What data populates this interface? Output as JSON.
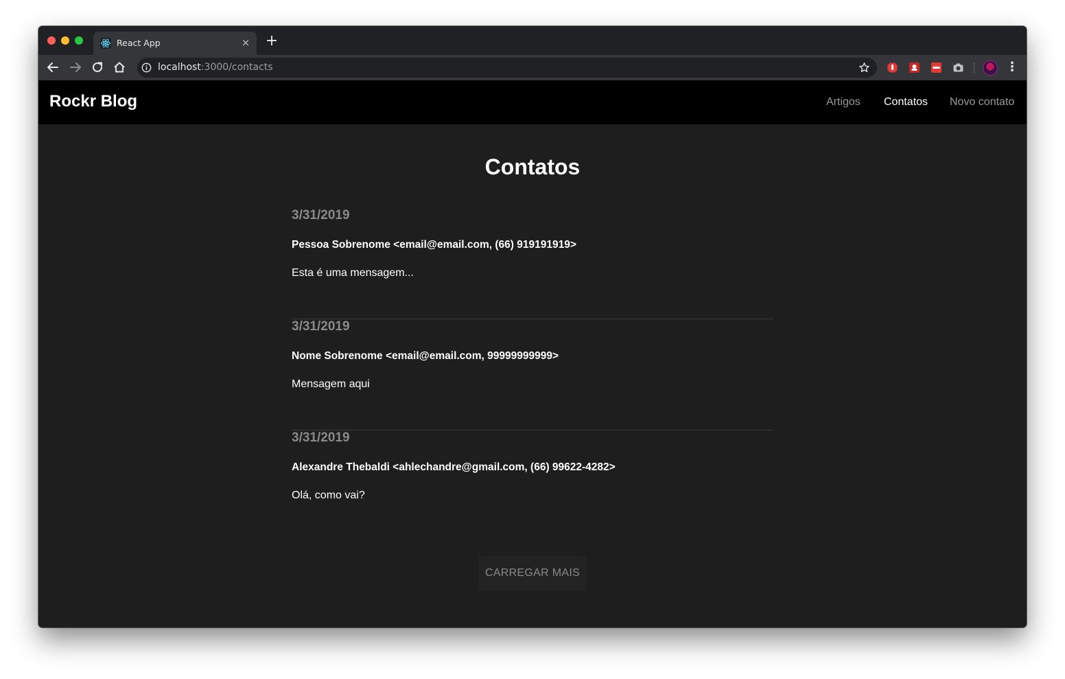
{
  "browser": {
    "tab_title": "React App",
    "tab_close": "×",
    "new_tab": "+",
    "url_host": "localhost",
    "url_path": ":3000/contacts",
    "menu": "⋮"
  },
  "nav": {
    "brand": "Rockr Blog",
    "links": [
      {
        "label": "Artigos",
        "active": false
      },
      {
        "label": "Contatos",
        "active": true
      },
      {
        "label": "Novo contato",
        "active": false
      }
    ]
  },
  "main": {
    "title": "Contatos",
    "contacts": [
      {
        "date": "3/31/2019",
        "from": "Pessoa Sobrenome <email@email.com, (66) 919191919>",
        "message": "Esta é uma mensagem..."
      },
      {
        "date": "3/31/2019",
        "from": "Nome Sobrenome <email@email.com, 99999999999>",
        "message": "Mensagem aqui"
      },
      {
        "date": "3/31/2019",
        "from": "Alexandre Thebaldi <ahlechandre@gmail.com, (66) 99622-4282>",
        "message": "Olá, como vai?"
      }
    ],
    "load_more_label": "CARREGAR MAIS"
  },
  "colors": {
    "page_bg": "#1e1e1e",
    "navbar_bg": "#000000",
    "muted_text": "#8a8a8a",
    "text": "#ffffff"
  },
  "icons": {
    "back": "back-arrow-icon",
    "forward": "forward-arrow-icon",
    "reload": "reload-icon",
    "home": "home-icon",
    "info": "info-icon",
    "bookmark": "star-icon",
    "favicon": "react-logo-icon"
  }
}
